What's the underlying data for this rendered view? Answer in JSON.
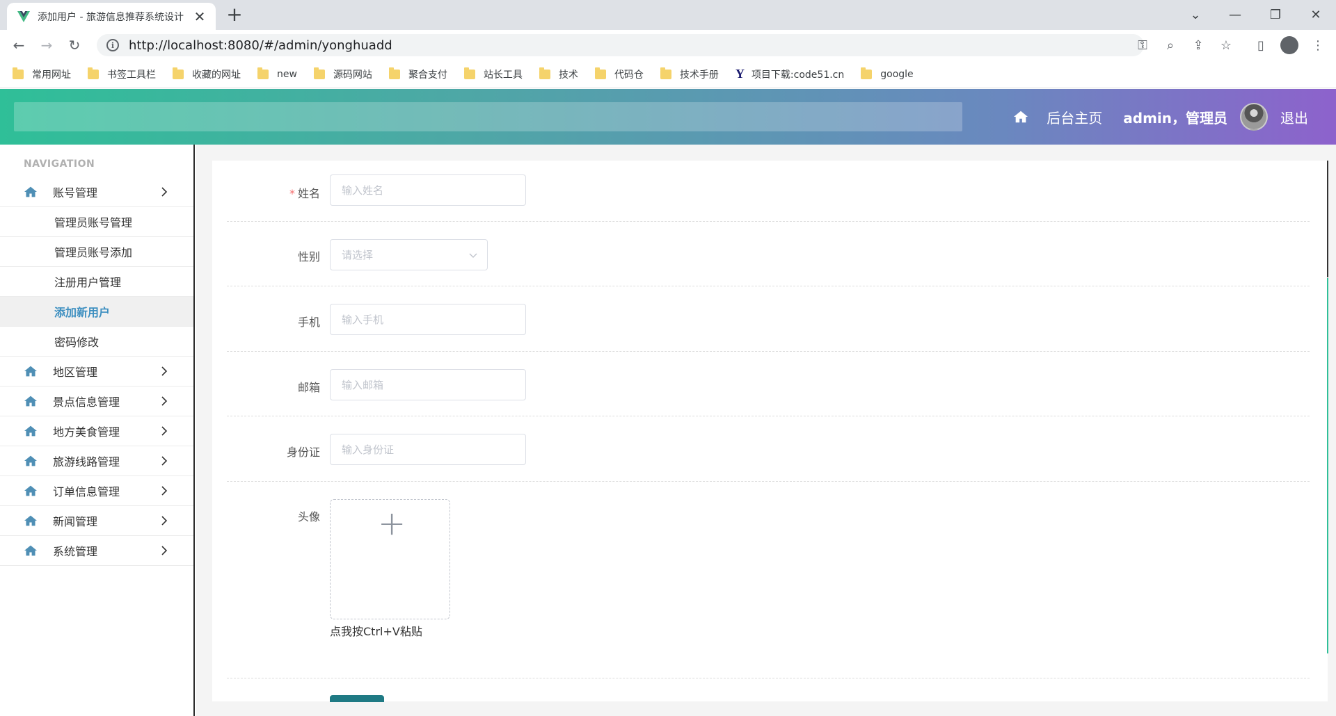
{
  "browser": {
    "tab_title": "添加用户 - 旅游信息推荐系统设计",
    "url": "http://localhost:8080/#/admin/yonghuadd",
    "bookmarks": [
      {
        "label": "常用网址",
        "icon": "folder-icon"
      },
      {
        "label": "书签工具栏",
        "icon": "folder-icon"
      },
      {
        "label": "收藏的网址",
        "icon": "folder-icon"
      },
      {
        "label": "new",
        "icon": "folder-icon"
      },
      {
        "label": "源码网站",
        "icon": "folder-icon"
      },
      {
        "label": "聚合支付",
        "icon": "folder-icon"
      },
      {
        "label": "站长工具",
        "icon": "folder-icon"
      },
      {
        "label": "技术",
        "icon": "folder-icon"
      },
      {
        "label": "代码仓",
        "icon": "folder-icon"
      },
      {
        "label": "技术手册",
        "icon": "folder-icon"
      },
      {
        "label": "项目下载:code51.cn",
        "icon": "y-logo-icon"
      },
      {
        "label": "google",
        "icon": "folder-icon"
      }
    ]
  },
  "header": {
    "home_label": "后台主页",
    "user_label": "admin，管理员",
    "logout_label": "退出",
    "gradient": [
      "#2fbf98",
      "#8d62cc"
    ]
  },
  "sidebar": {
    "nav_title": "NAVIGATION",
    "account_menu": "账号管理",
    "sub_items": [
      "管理员账号管理",
      "管理员账号添加",
      "注册用户管理",
      "添加新用户",
      "密码修改"
    ],
    "active_sub": "添加新用户",
    "menus": [
      "地区管理",
      "景点信息管理",
      "地方美食管理",
      "旅游线路管理",
      "订单信息管理",
      "新闻管理",
      "系统管理"
    ]
  },
  "form": {
    "name_label": "姓名",
    "name_required": "*",
    "name_placeholder": "输入姓名",
    "gender_label": "性别",
    "gender_placeholder": "请选择",
    "phone_label": "手机",
    "phone_placeholder": "输入手机",
    "email_label": "邮箱",
    "email_placeholder": "输入邮箱",
    "idcard_label": "身份证",
    "idcard_placeholder": "输入身份证",
    "avatar_label": "头像",
    "upload_plus": "+",
    "paste_hint": "点我按Ctrl+V粘贴"
  },
  "colors": {
    "accent": "#2fbf98",
    "active_link": "#3d8fc0",
    "submit": "#1f7a84"
  }
}
